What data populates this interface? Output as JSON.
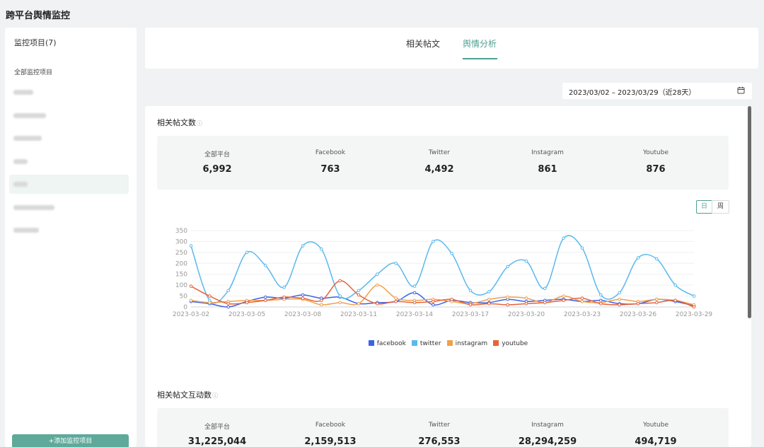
{
  "app": {
    "title": "跨平台舆情监控"
  },
  "sidebar": {
    "header": "监控项目(7)",
    "all_label": "全部监控项目",
    "items": [
      {
        "blur_width": 28,
        "active": false
      },
      {
        "blur_width": 46,
        "active": false
      },
      {
        "blur_width": 40,
        "active": false
      },
      {
        "blur_width": 20,
        "active": false
      },
      {
        "blur_width": 20,
        "active": true
      },
      {
        "blur_width": 58,
        "active": false
      },
      {
        "blur_width": 36,
        "active": false
      }
    ],
    "add_button": "+添加监控项目"
  },
  "tabs": [
    {
      "label": "相关帖文",
      "active": false
    },
    {
      "label": "舆情分析",
      "active": true
    }
  ],
  "date_range": {
    "text": "2023/03/02 – 2023/03/29（近28天）",
    "icon": "calendar-icon"
  },
  "posts_section": {
    "title": "相关帖文数",
    "info_icon": "ⓘ",
    "stats": [
      {
        "label": "全部平台",
        "value": "6,992"
      },
      {
        "label": "Facebook",
        "value": "763"
      },
      {
        "label": "Twitter",
        "value": "4,492"
      },
      {
        "label": "Instagram",
        "value": "861"
      },
      {
        "label": "Youtube",
        "value": "876"
      }
    ],
    "toggle": {
      "day": "日",
      "week": "周"
    }
  },
  "interaction_section": {
    "title": "相关帖文互动数",
    "info_icon": "ⓘ",
    "stats": [
      {
        "label": "全部平台",
        "value": "31,225,044"
      },
      {
        "label": "Facebook",
        "value": "2,159,513"
      },
      {
        "label": "Twitter",
        "value": "276,553"
      },
      {
        "label": "Instagram",
        "value": "28,294,259"
      },
      {
        "label": "Youtube",
        "value": "494,719"
      }
    ]
  },
  "colors": {
    "accent": "#4e9f8f",
    "facebook": "#3c62e8",
    "twitter": "#5bb8ee",
    "instagram": "#f0a04b",
    "youtube": "#e8623a"
  },
  "chart_data": {
    "type": "line",
    "x": [
      "2023-03-02",
      "2023-03-03",
      "2023-03-04",
      "2023-03-05",
      "2023-03-06",
      "2023-03-07",
      "2023-03-08",
      "2023-03-09",
      "2023-03-10",
      "2023-03-11",
      "2023-03-12",
      "2023-03-13",
      "2023-03-14",
      "2023-03-15",
      "2023-03-16",
      "2023-03-17",
      "2023-03-18",
      "2023-03-19",
      "2023-03-20",
      "2023-03-21",
      "2023-03-22",
      "2023-03-23",
      "2023-03-24",
      "2023-03-25",
      "2023-03-26",
      "2023-03-27",
      "2023-03-28",
      "2023-03-29"
    ],
    "x_tick_labels": [
      "2023-03-02",
      "2023-03-05",
      "2023-03-08",
      "2023-03-11",
      "2023-03-14",
      "2023-03-17",
      "2023-03-20",
      "2023-03-23",
      "2023-03-26",
      "2023-03-29"
    ],
    "series": [
      {
        "name": "facebook",
        "color": "#3c62e8",
        "values": [
          25,
          15,
          0,
          25,
          45,
          40,
          55,
          40,
          45,
          15,
          20,
          25,
          65,
          10,
          30,
          20,
          20,
          35,
          25,
          30,
          35,
          25,
          30,
          15,
          15,
          35,
          25,
          5
        ]
      },
      {
        "name": "twitter",
        "color": "#5bb8ee",
        "values": [
          280,
          30,
          75,
          250,
          190,
          90,
          280,
          265,
          50,
          75,
          150,
          200,
          95,
          300,
          245,
          75,
          70,
          185,
          210,
          85,
          315,
          270,
          55,
          65,
          225,
          220,
          100,
          50
        ]
      },
      {
        "name": "instagram",
        "color": "#f0a04b",
        "values": [
          30,
          20,
          25,
          30,
          30,
          35,
          35,
          10,
          20,
          15,
          100,
          40,
          30,
          35,
          25,
          15,
          35,
          45,
          40,
          20,
          50,
          25,
          20,
          35,
          25,
          35,
          30,
          10
        ]
      },
      {
        "name": "youtube",
        "color": "#e8623a",
        "values": [
          95,
          50,
          15,
          20,
          30,
          45,
          40,
          30,
          120,
          55,
          15,
          25,
          20,
          25,
          35,
          10,
          15,
          10,
          15,
          20,
          30,
          40,
          15,
          10,
          15,
          20,
          30,
          0
        ]
      }
    ],
    "ylim": [
      0,
      350
    ],
    "y_ticks": [
      0,
      50,
      100,
      150,
      200,
      250,
      300,
      350
    ],
    "grid": true,
    "legend": "bottom"
  }
}
